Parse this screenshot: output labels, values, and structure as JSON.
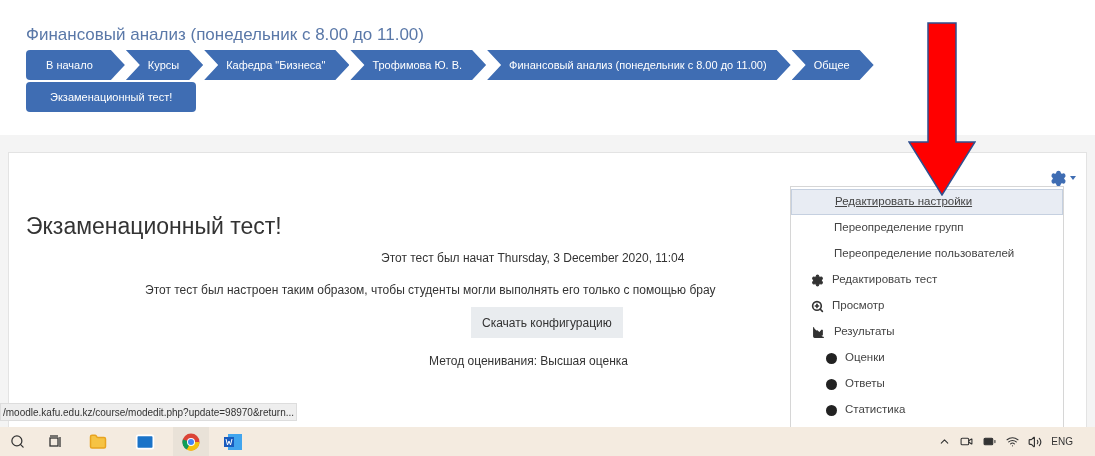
{
  "course_title": "Финансовый анализ (понедельник с 8.00 до 11.00)",
  "breadcrumbs": [
    {
      "label": "В начало"
    },
    {
      "label": "Курсы"
    },
    {
      "label": "Кафедра \"Бизнеса\""
    },
    {
      "label": "Трофимова Ю. В."
    },
    {
      "label": "Финансовый анализ (понедельник с 8.00 до 11.00)"
    },
    {
      "label": "Общее"
    },
    {
      "label": "Экзаменационный тест!"
    }
  ],
  "page_title": "Экзаменационный тест!",
  "info_lines": [
    "Этот тест был начат Thursday, 3 December 2020, 11:04",
    "Этот тест был настроен таким образом, чтобы студенты могли выполнять его только с помощью брау"
  ],
  "download_button": "Скачать конфигурацию",
  "grading_method": "Метод оценивания: Высшая оценка",
  "menu": [
    {
      "label": "Редактировать настройки",
      "kind": "plain",
      "selected": true
    },
    {
      "label": "Переопределение групп",
      "kind": "plain",
      "selected": false
    },
    {
      "label": "Переопределение пользователей",
      "kind": "plain",
      "selected": false
    },
    {
      "label": "Редактировать тест",
      "kind": "gear",
      "selected": false
    },
    {
      "label": "Просмотр",
      "kind": "zoom",
      "selected": false
    },
    {
      "label": "Результаты",
      "kind": "chart",
      "selected": false
    },
    {
      "label": "Оценки",
      "kind": "bullet",
      "selected": false
    },
    {
      "label": "Ответы",
      "kind": "bullet",
      "selected": false
    },
    {
      "label": "Статистика",
      "kind": "bullet",
      "selected": false
    }
  ],
  "status_url": "/moodle.kafu.edu.kz/course/modedit.php?update=98970&return...",
  "taskbar": {
    "language": "ENG"
  }
}
